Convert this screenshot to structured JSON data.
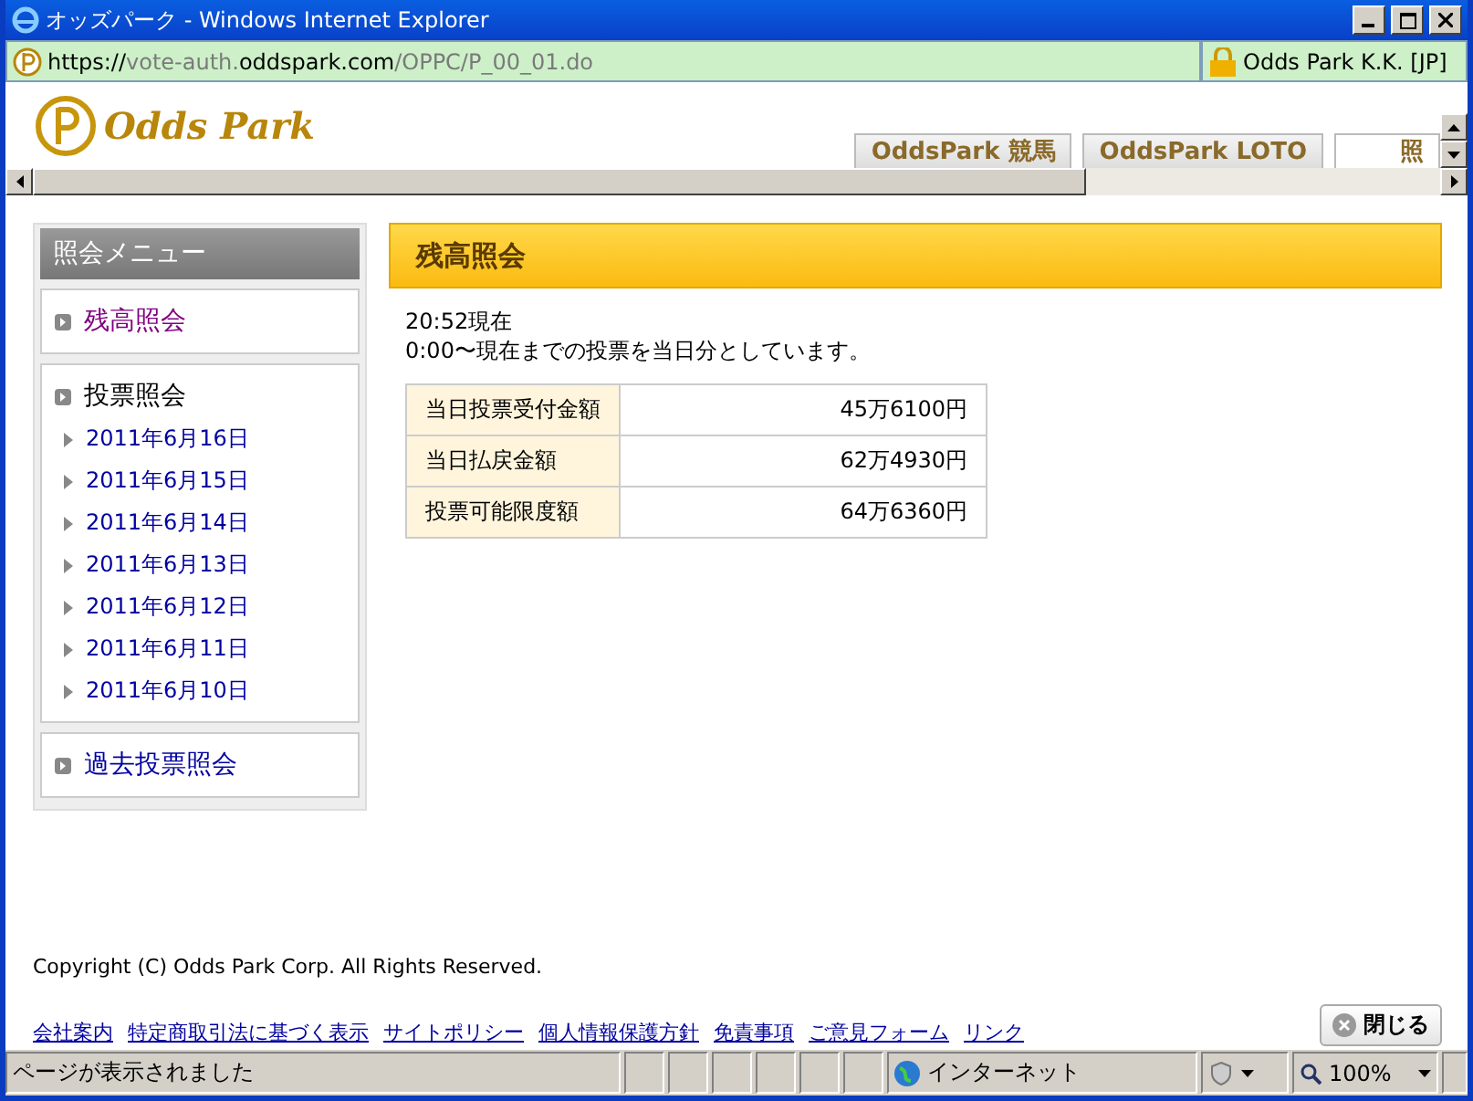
{
  "window": {
    "title": "オッズパーク - Windows Internet Explorer"
  },
  "address_bar": {
    "url_parts": [
      {
        "text": "https://",
        "strong": true
      },
      {
        "text": "vote-auth.",
        "strong": false
      },
      {
        "text": "oddspark.com",
        "strong": true
      },
      {
        "text": "/OPPC/P_00_01.do",
        "strong": false
      }
    ],
    "certificate": "Odds Park K.K. [JP]"
  },
  "header": {
    "logo": "Odds Park",
    "tabs": [
      {
        "label": "OddsPark 競馬",
        "selected": false
      },
      {
        "label": "OddsPark LOTO",
        "selected": false
      },
      {
        "label": "照",
        "selected": true
      }
    ]
  },
  "sidebar": {
    "title": "照会メニュー",
    "sections": [
      {
        "label": "残高照会",
        "kind": "link",
        "selected": true
      },
      {
        "label": "投票照会",
        "kind": "heading",
        "selected": false,
        "children": [
          {
            "label": "2011年6月16日"
          },
          {
            "label": "2011年6月15日"
          },
          {
            "label": "2011年6月14日"
          },
          {
            "label": "2011年6月13日"
          },
          {
            "label": "2011年6月12日"
          },
          {
            "label": "2011年6月11日"
          },
          {
            "label": "2011年6月10日"
          }
        ]
      },
      {
        "label": "過去投票照会",
        "kind": "link",
        "selected": false
      }
    ]
  },
  "main": {
    "title": "残高照会",
    "timestamp": "20:52現在",
    "note": "0:00〜現在までの投票を当日分としています。",
    "table": {
      "rows": [
        {
          "label": "当日投票受付金額",
          "value": "45万6100円"
        },
        {
          "label": "当日払戻金額",
          "value": "62万4930円"
        },
        {
          "label": "投票可能限度額",
          "value": "64万6360円"
        }
      ]
    }
  },
  "footer": {
    "copyright": "Copyright (C) Odds Park Corp. All Rights Reserved.",
    "links": [
      "会社案内",
      "特定商取引法に基づく表示",
      "サイトポリシー",
      "個人情報保護方針",
      "免責事項",
      "ご意見フォーム",
      "リンク"
    ],
    "close_button": "閉じる"
  },
  "status_bar": {
    "message": "ページが表示されました",
    "zone": "インターネット",
    "zoom": "100%"
  }
}
